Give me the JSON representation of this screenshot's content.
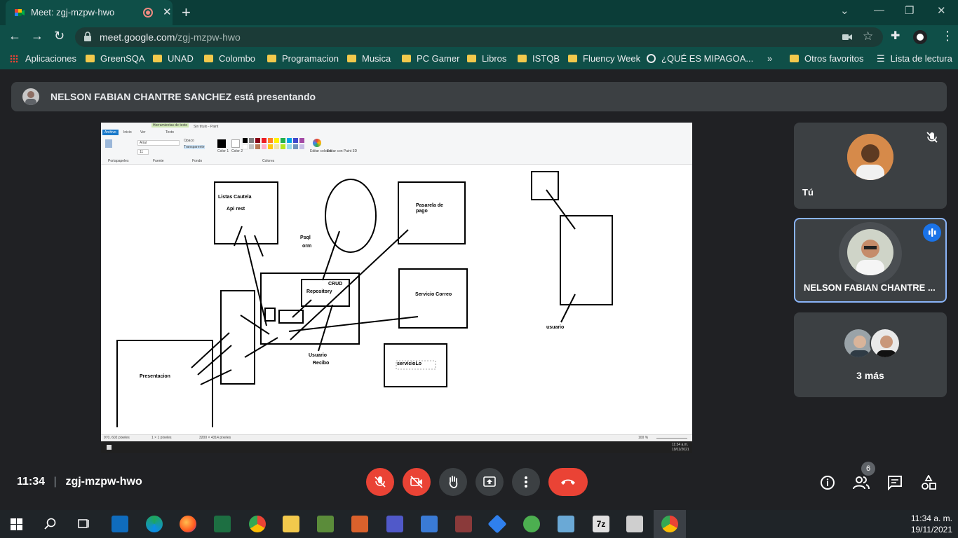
{
  "browser": {
    "tab_title": "Meet: zgj-mzpw-hwo",
    "url_domain": "meet.google.com",
    "url_path": "/zgj-mzpw-hwo",
    "bookmarks": [
      "Aplicaciones",
      "GreenSQA",
      "UNAD",
      "Colombo",
      "Programacion",
      "Musica",
      "PC Gamer",
      "Libros",
      "ISTQB",
      "Fluency Week",
      "¿QUÉ ES MIPAGOA...",
      "Otros favoritos",
      "Lista de lectura"
    ],
    "overflow": "»"
  },
  "meet": {
    "presenting_banner": "NELSON FABIAN CHANTRE SANCHEZ está presentando",
    "tiles": {
      "self_label": "Tú",
      "presenter_label": "NELSON FABIAN CHANTRE ...",
      "more_label": "3 más"
    },
    "time": "11:34",
    "meeting_code": "zgj-mzpw-hwo",
    "participants_badge": "6"
  },
  "paint": {
    "title": "Sin título - Paint",
    "context_tab": "Herramientas de texto",
    "tabs": [
      "Archivo",
      "Inicio",
      "Ver",
      "Texto"
    ],
    "font": "Arial",
    "font_size": "11",
    "opaque": "Opaco",
    "transparent": "Transparente",
    "groups": [
      "Portapapeles",
      "Fuente",
      "Fondo",
      "Colores"
    ],
    "color1": "Color 1",
    "color2": "Color 2",
    "edit_colors": "Editar colores",
    "edit_paint3d": "Editar con Paint 3D",
    "diagram_labels": {
      "listas": "Listas Cautela",
      "api": "Api rest",
      "psql": "Psql",
      "orm": "orm",
      "pasarela": "Pasarela de pago",
      "crud": "CRUD",
      "repository": "Repository",
      "correo": "Servicio Correo",
      "usuario": "Usuario",
      "recibo": "Recibo",
      "servicio": "servicioLo",
      "presentacion": "Presentacion",
      "usuario2": "usuario"
    },
    "status_coords": "970, 602 píxeles",
    "status_sel": "1 × 1 píxeles",
    "status_size": "3200 × 4314 píxeles",
    "zoom": "100 %",
    "remote_clock_time": "11:34 a.m.",
    "remote_clock_date": "19/11/2021"
  },
  "taskbar": {
    "clock_time": "11:34 a. m.",
    "clock_date": "19/11/2021"
  },
  "colors": {
    "chrome_frame": "#0b3d38",
    "chrome_toolbar": "#0f4f48",
    "meet_bg": "#202124",
    "tile_bg": "#3c4043",
    "end_call": "#ea4335",
    "active_speaker": "#8ab4f8"
  }
}
